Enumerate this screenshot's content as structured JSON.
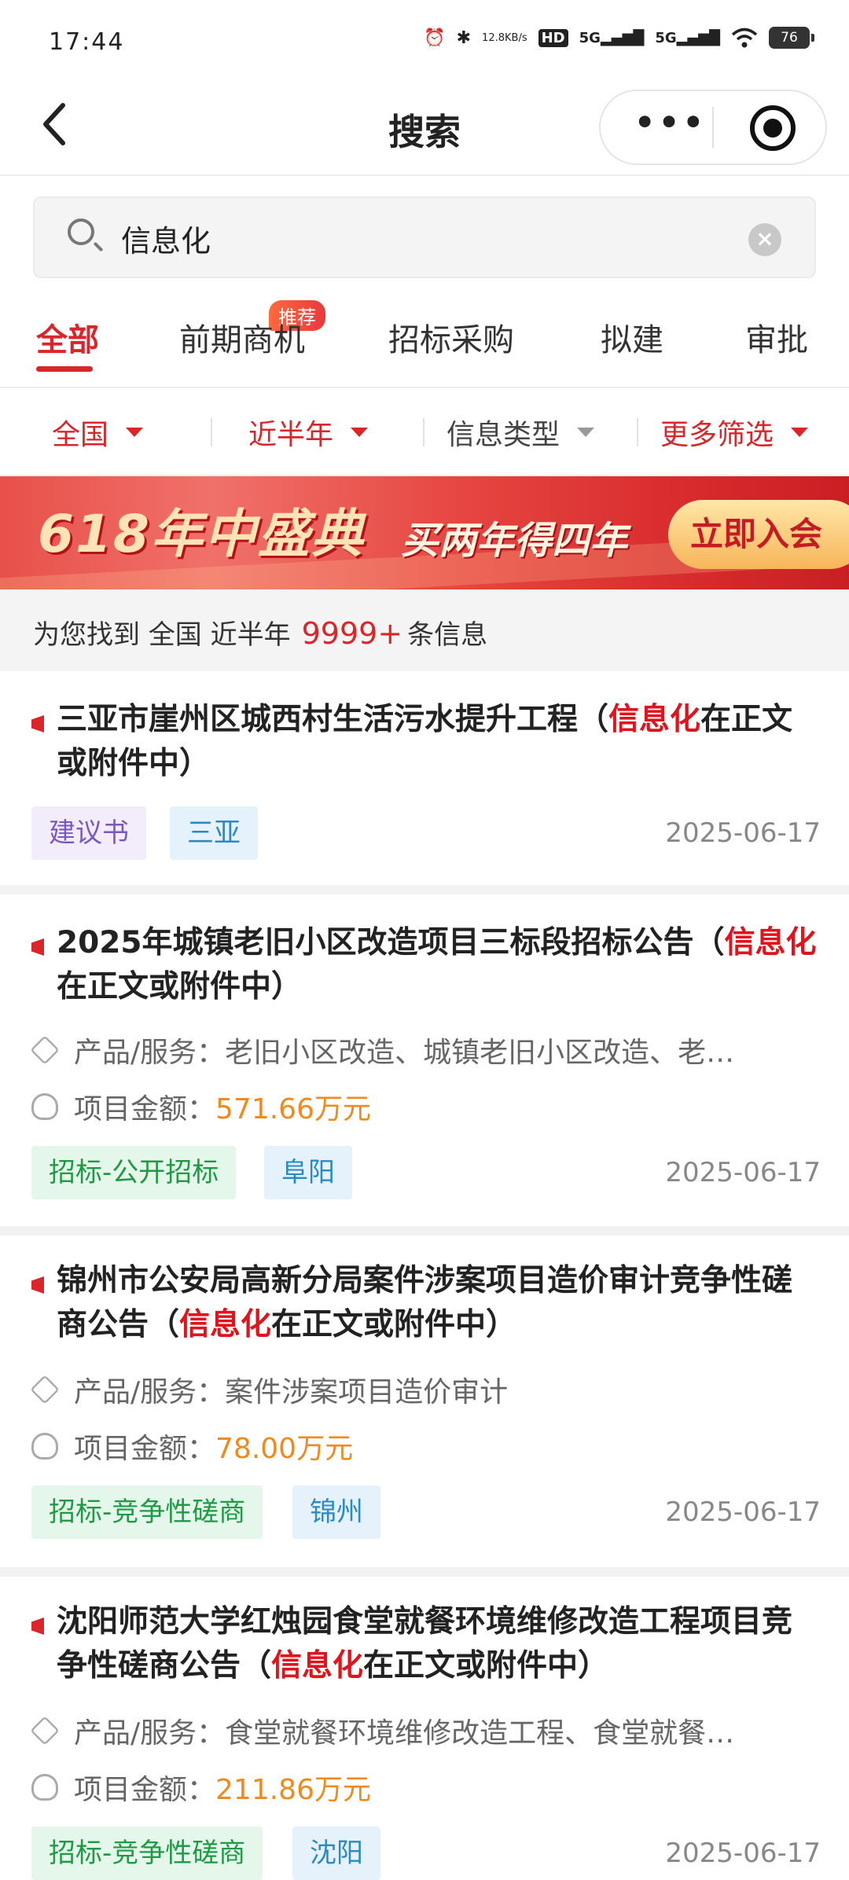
{
  "status": {
    "time": "17:44",
    "speed_top": "12.8",
    "speed_unit": "KB/s",
    "hd": "HD",
    "net1": "5G",
    "net2": "5G",
    "battery": "76"
  },
  "nav": {
    "back": "‹",
    "title": "搜索",
    "menu": "•••"
  },
  "search": {
    "query": "信息化",
    "clear": "×"
  },
  "tabs": [
    {
      "label": "全部",
      "active": true
    },
    {
      "label": "前期商机",
      "badge": "推荐"
    },
    {
      "label": "招标采购"
    },
    {
      "label": "拟建"
    },
    {
      "label": "审批"
    }
  ],
  "filters": [
    {
      "label": "全国",
      "color": "#d9262b"
    },
    {
      "label": "近半年",
      "color": "#d9262b"
    },
    {
      "label": "信息类型",
      "color": "#444444"
    },
    {
      "label": "更多筛选",
      "color": "#d9262b"
    }
  ],
  "banner": {
    "main": "618年中盛典",
    "sub": "买两年得四年",
    "button": "立即入会"
  },
  "result": {
    "prefix": "为您找到 全国 近半年",
    "count": "9999+",
    "suffix": "条信息"
  },
  "cards": [
    {
      "title_pre": "三亚市崖州区城西村生活污水提升工程（",
      "title_hl": "信息化",
      "title_post": "在正文或附件中）",
      "tags": [
        "建议书",
        "三亚"
      ],
      "date": "2025-06-17"
    },
    {
      "title_pre": "2025年城镇老旧小区改造项目三标段招标公告（",
      "title_hl": "信息化",
      "title_post": "在正文或附件中）",
      "product_label": "产品/服务：",
      "product_value": "老旧小区改造、城镇老旧小区改造、老…",
      "amount_label": "项目金额：",
      "amount_value": "571.66万元",
      "tags": [
        "招标-公开招标",
        "阜阳"
      ],
      "date": "2025-06-17"
    },
    {
      "title_pre": "锦州市公安局高新分局案件涉案项目造价审计竞争性磋商公告（",
      "title_hl": "信息化",
      "title_post": "在正文或附件中）",
      "product_label": "产品/服务：",
      "product_value": "案件涉案项目造价审计",
      "amount_label": "项目金额：",
      "amount_value": "78.00万元",
      "tags": [
        "招标-竞争性磋商",
        "锦州"
      ],
      "date": "2025-06-17"
    },
    {
      "title_pre": "沈阳师范大学红烛园食堂就餐环境维修改造工程项目竞争性磋商公告（",
      "title_hl": "信息化",
      "title_post": "在正文或附件中）",
      "product_label": "产品/服务：",
      "product_value": "食堂就餐环境维修改造工程、食堂就餐…",
      "amount_label": "项目金额：",
      "amount_value": "211.86万元",
      "tags": [
        "招标-竞争性磋商",
        "沈阳"
      ],
      "date": "2025-06-17"
    }
  ]
}
